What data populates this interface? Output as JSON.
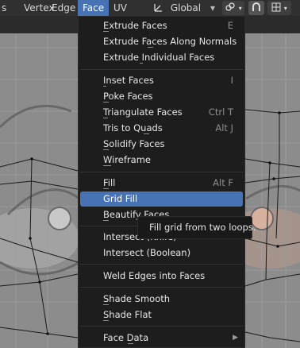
{
  "header": {
    "menus": [
      {
        "label": "Vertex"
      },
      {
        "label": "Edge"
      },
      {
        "label": "Face",
        "active": true
      },
      {
        "label": "UV"
      }
    ],
    "orientation": {
      "icon": "transform-orientation-icon",
      "label": "Global",
      "caret": "⌄"
    },
    "snap_icon": "link-icon",
    "proportional_icon": "magnet-icon",
    "grid_icon": "grid-icon"
  },
  "menu": {
    "items": [
      {
        "label": "Extrude Faces",
        "shortcut": "E"
      },
      {
        "label": "Extrude Faces Along Normals",
        "shortcut": ""
      },
      {
        "label": "Extrude Individual Faces",
        "shortcut": ""
      },
      {
        "label": "Inset Faces",
        "shortcut": "I"
      },
      {
        "label": "Poke Faces",
        "shortcut": ""
      },
      {
        "label": "Triangulate Faces",
        "shortcut": "Ctrl T"
      },
      {
        "label": "Tris to Quads",
        "shortcut": "Alt J"
      },
      {
        "label": "Solidify Faces",
        "shortcut": ""
      },
      {
        "label": "Wireframe",
        "shortcut": ""
      },
      {
        "label": "Fill",
        "shortcut": "Alt F"
      },
      {
        "label": "Grid Fill",
        "shortcut": "",
        "highlighted": true
      },
      {
        "label": "Beautify Faces",
        "shortcut": ""
      },
      {
        "label": "Intersect (Knife)",
        "shortcut": ""
      },
      {
        "label": "Intersect (Boolean)",
        "shortcut": ""
      },
      {
        "label": "Weld Edges into Faces",
        "shortcut": ""
      },
      {
        "label": "Shade Smooth",
        "shortcut": ""
      },
      {
        "label": "Shade Flat",
        "shortcut": ""
      },
      {
        "label": "Face Data",
        "shortcut": "",
        "submenu": true
      }
    ]
  },
  "tooltip": {
    "text": "Fill grid from two loops."
  },
  "colors": {
    "accent": "#4772b3",
    "menu_bg": "#1d1d1d",
    "header_bg": "#303030"
  }
}
